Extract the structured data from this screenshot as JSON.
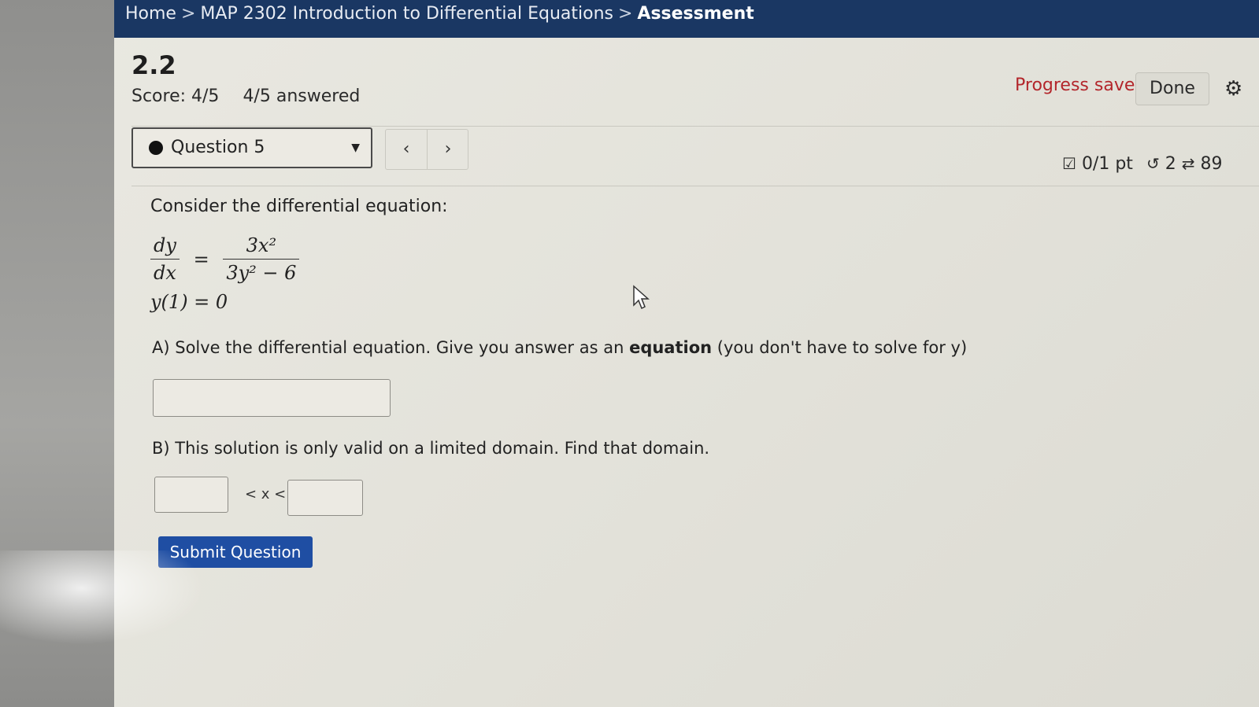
{
  "breadcrumb": {
    "home": "Home",
    "separator": ">",
    "course": "MAP 2302 Introduction to Differential Equations",
    "current": "Assessment"
  },
  "assignment": {
    "title": "2.2",
    "score": "Score: 4/5",
    "answered": "4/5 answered"
  },
  "status": {
    "progress": "Progress saved",
    "done_label": "Done"
  },
  "question_nav": {
    "selected": "Question 5",
    "prev_icon": "chevron-left-icon",
    "next_icon": "chevron-right-icon"
  },
  "question_meta": {
    "points": "0/1 pt",
    "retries": "2",
    "attempts": "89"
  },
  "question": {
    "prompt": "Consider the differential equation:",
    "lhs_num": "dy",
    "lhs_den": "dx",
    "rhs_num": "3x²",
    "rhs_den": "3y² − 6",
    "equals": "=",
    "initial_condition": "y(1) = 0",
    "part_a_pre": "A) Solve the differential equation. Give you answer as an ",
    "part_a_bold": "equation",
    "part_a_post": " (you don't have to solve for y)",
    "part_b": "B) This solution is only valid on a limited domain. Find that domain.",
    "inequality": "< x <",
    "submit_label": "Submit Question"
  },
  "colors": {
    "topbar": "#1a3763",
    "progress_text": "#b3262b",
    "submit_button": "#1f4ea3"
  }
}
